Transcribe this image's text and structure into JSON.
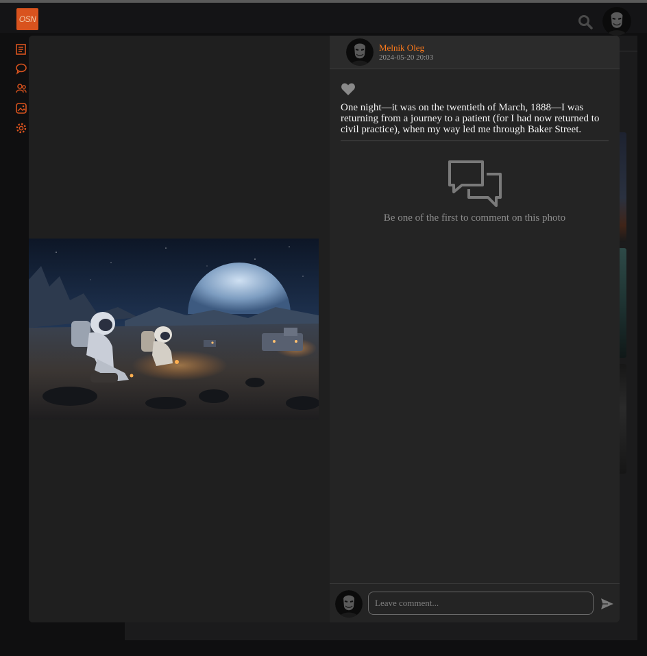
{
  "app": {
    "logo_text": "OSN"
  },
  "colors": {
    "accent": "#ff7a1a",
    "logo_bg": "#d9531e",
    "modal_bg": "#1f1f1f",
    "panel_bg": "#242424"
  },
  "topbar": {
    "icons": [
      "search-icon",
      "user-avatar"
    ]
  },
  "sidebar": {
    "icons": [
      "news-icon",
      "messages-icon",
      "friends-icon",
      "photos-icon",
      "settings-icon"
    ]
  },
  "post": {
    "author": "Melnik Oleg",
    "date": "2024-05-20 20:03",
    "caption": "One night—it was on the twentieth of March, 1888—I was returning from a journey to a patient (for I had now returned to civil practice), when my way led me through Baker Street.",
    "image_alt": "Astronauts resting on a rocky lunar surface beneath a large planet"
  },
  "comments": {
    "empty_text": "Be one of the first to comment on this photo",
    "input_placeholder": "Leave comment..."
  }
}
